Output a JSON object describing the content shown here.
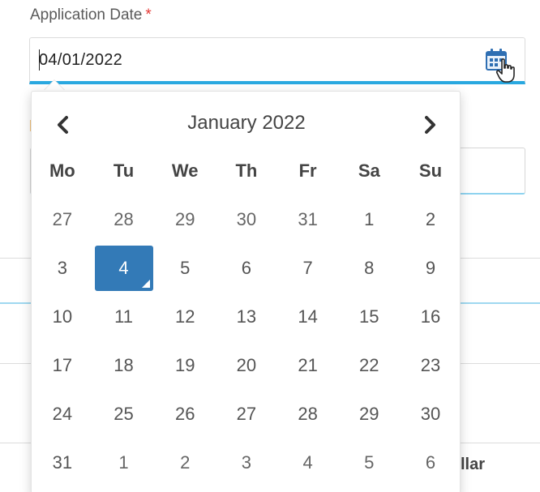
{
  "field": {
    "label": "Application Date",
    "required_mark": "*",
    "value": "04/01/2022"
  },
  "calendar": {
    "month_title": "January 2022",
    "weekdays": [
      "Mo",
      "Tu",
      "We",
      "Th",
      "Fr",
      "Sa",
      "Su"
    ],
    "weeks": [
      [
        "27",
        "28",
        "29",
        "30",
        "31",
        "1",
        "2"
      ],
      [
        "3",
        "4",
        "5",
        "6",
        "7",
        "8",
        "9"
      ],
      [
        "10",
        "11",
        "12",
        "13",
        "14",
        "15",
        "16"
      ],
      [
        "17",
        "18",
        "19",
        "20",
        "21",
        "22",
        "23"
      ],
      [
        "24",
        "25",
        "26",
        "27",
        "28",
        "29",
        "30"
      ],
      [
        "31",
        "1",
        "2",
        "3",
        "4",
        "5",
        "6"
      ]
    ],
    "selected": "4"
  },
  "background": {
    "partial_text": "llar"
  },
  "colors": {
    "accent": "#29a8e0",
    "selected": "#337ab7",
    "required": "#e53935"
  },
  "icons": {
    "calendar": "calendar-icon",
    "cursor": "hand-pointer-icon",
    "prev": "chevron-left-icon",
    "next": "chevron-right-icon"
  }
}
